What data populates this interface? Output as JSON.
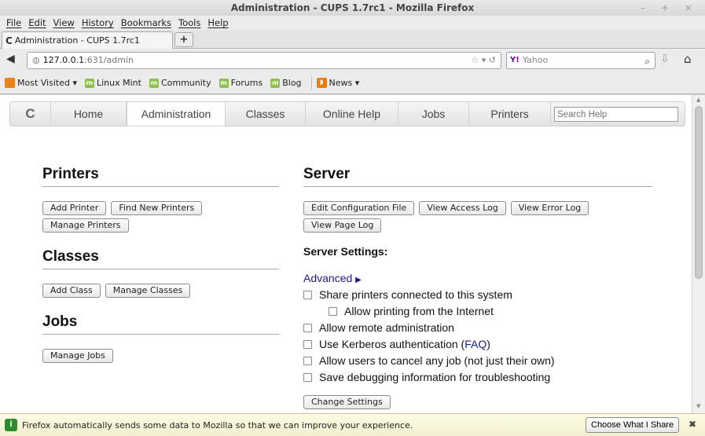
{
  "window": {
    "title": "Administration - CUPS 1.7rc1 - Mozilla Firefox",
    "controls": "– + ×"
  },
  "menu": [
    "File",
    "Edit",
    "View",
    "History",
    "Bookmarks",
    "Tools",
    "Help"
  ],
  "tab": {
    "label": "Administration - CUPS 1.7rc1",
    "icon_glyph": "C",
    "new_tab_glyph": "+"
  },
  "nav": {
    "url_host": "127.0.0.1",
    "url_path": ":631/admin",
    "url_right_glyphs": "☆ ▾ ↺",
    "search_engine": "Yahoo",
    "search_engine_badge": "Y!",
    "search_icon_glyph": "⌕"
  },
  "bookmarks": [
    {
      "label": "Most Visited ▾",
      "icon": "most-visited-icon"
    },
    {
      "label": "Linux Mint",
      "icon": "mint-icon"
    },
    {
      "label": "Community",
      "icon": "mint-icon"
    },
    {
      "label": "Forums",
      "icon": "mint-icon"
    },
    {
      "label": "Blog",
      "icon": "mint-icon"
    },
    {
      "label": "News ▾",
      "icon": "rss-icon"
    }
  ],
  "cups": {
    "logo": "C",
    "nav_items": [
      {
        "label": "Home",
        "width": 96
      },
      {
        "label": "Administration",
        "width": 126
      },
      {
        "label": "Classes",
        "width": 102
      },
      {
        "label": "Online Help",
        "width": 118
      },
      {
        "label": "Jobs",
        "width": 90
      },
      {
        "label": "Printers",
        "width": 104
      }
    ],
    "active_tab": "Administration",
    "search_placeholder": "Search Help",
    "printers": {
      "heading": "Printers",
      "buttons": [
        "Add Printer",
        "Find New Printers",
        "Manage Printers"
      ]
    },
    "classes": {
      "heading": "Classes",
      "buttons": [
        "Add Class",
        "Manage Classes"
      ]
    },
    "jobs": {
      "heading": "Jobs",
      "buttons": [
        "Manage Jobs"
      ]
    },
    "server": {
      "heading": "Server",
      "buttons": [
        "Edit Configuration File",
        "View Access Log",
        "View Error Log",
        "View Page Log"
      ],
      "settings_heading": "Server Settings:",
      "advanced_link": "Advanced",
      "options": [
        {
          "label": "Share printers connected to this system",
          "checked": false
        },
        {
          "label": "Allow printing from the Internet",
          "checked": false
        },
        {
          "label": "Allow remote administration",
          "checked": false
        },
        {
          "label": "Use Kerberos authentication (",
          "link": "FAQ",
          "suffix": ")",
          "checked": false
        },
        {
          "label": "Allow users to cancel any job (not just their own)",
          "checked": false
        },
        {
          "label": "Save debugging information for troubleshooting",
          "checked": false
        }
      ],
      "change_button": "Change Settings"
    }
  },
  "notification": {
    "message": "Firefox automatically sends some data to Mozilla so that we can improve your experience.",
    "button": "Choose What I Share",
    "close_glyph": "✖"
  }
}
